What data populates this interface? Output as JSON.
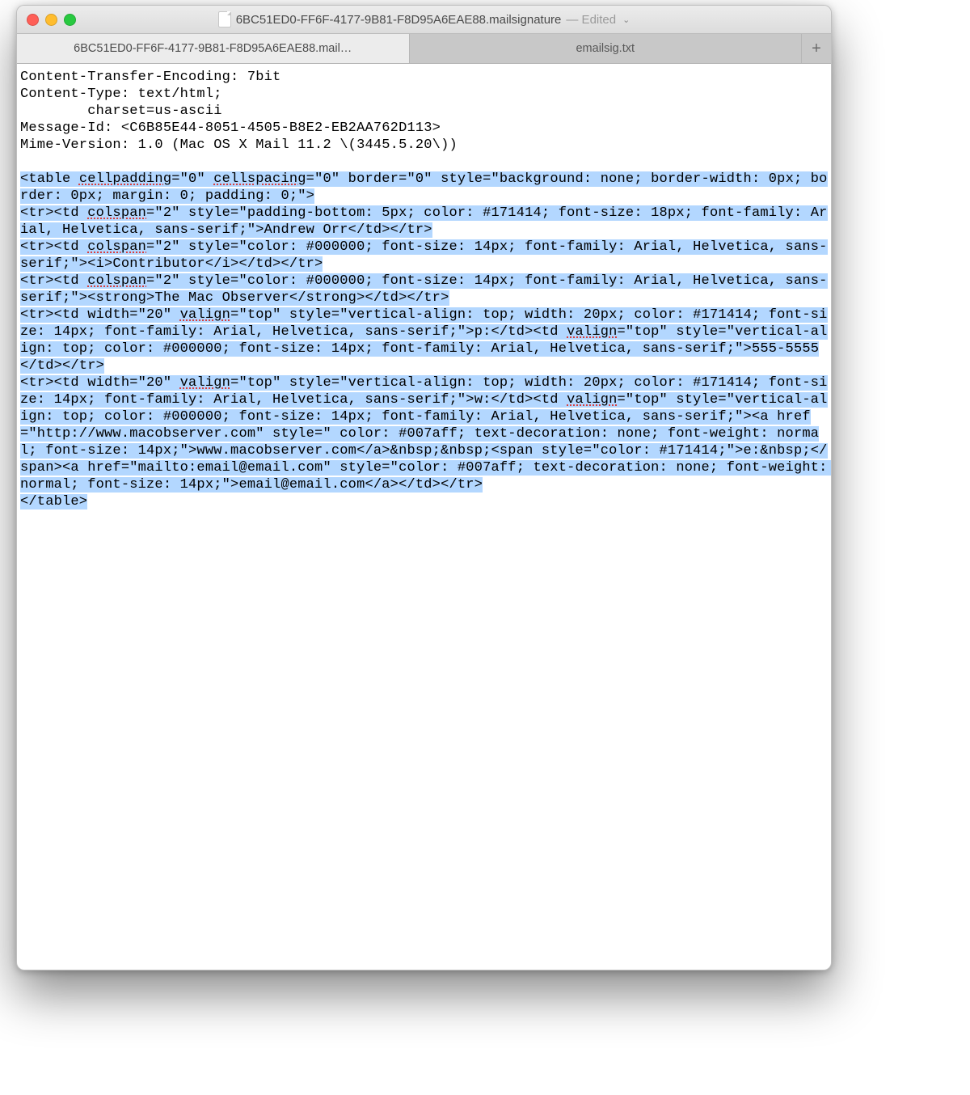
{
  "window": {
    "filename": "6BC51ED0-FF6F-4177-9B81-F8D95A6EAE88.mailsignature",
    "status": "— Edited"
  },
  "tabs": {
    "active": "6BC51ED0-FF6F-4177-9B81-F8D95A6EAE88.mail…",
    "inactive": "emailsig.txt",
    "newtab": "+"
  },
  "headers": {
    "l1": "Content-Transfer-Encoding: 7bit",
    "l2": "Content-Type: text/html;",
    "l3": "        charset=us-ascii",
    "l4": "Message-Id: <C6B85E44-8051-4505-B8E2-EB2AA762D113>",
    "l5": "Mime-Version: 1.0 (Mac OS X Mail 11.2 \\(3445.5.20\\))"
  },
  "body": {
    "s01a": "<table ",
    "s01b": "cellpadding",
    "s01c": "=\"0\" ",
    "s01d": "cellspacing",
    "s01e": "=\"0\" border=\"0\" style=\"background: none; border-width: 0px; border: 0px; margin: 0; padding: 0;\">",
    "s02a": "<tr><td ",
    "s02b": "colspan",
    "s02c": "=\"2\" style=\"padding-bottom: 5px; color: #171414; font-size: 18px; font-family: Arial, Helvetica, sans-serif;\">Andrew Orr</td></tr>",
    "s03a": "<tr><td ",
    "s03b": "colspan",
    "s03c": "=\"2\" style=\"color: #000000; font-size: 14px; font-family: Arial, Helvetica, sans-serif;\"><i>Contributor</i></td></tr>",
    "s04a": "<tr><td ",
    "s04b": "colspan",
    "s04c": "=\"2\" style=\"color: #000000; font-size: 14px; font-family: Arial, Helvetica, sans-serif;\"><strong>The Mac Observer</strong></td></tr>",
    "s05a": "<tr><td width=\"20\" ",
    "s05b": "valign",
    "s05c": "=\"top\" style=\"vertical-align: top; width: 20px; color: #171414; font-size: 14px; font-family: Arial, Helvetica, sans-serif;\">p:</td><td ",
    "s05d": "valign",
    "s05e": "=\"top\" style=\"vertical-align: top; color: #000000; font-size: 14px; font-family: Arial, Helvetica, sans-serif;\">555-5555</td></tr>",
    "s06a": "<tr><td width=\"20\" ",
    "s06b": "valign",
    "s06c": "=\"top\" style=\"vertical-align: top; width: 20px; color: #171414; font-size: 14px; font-family: Arial, Helvetica, sans-serif;\">w:</td><td ",
    "s06d": "valign",
    "s06e": "=\"top\" style=\"vertical-align: top; color: #000000; font-size: 14px; font-family: Arial, Helvetica, sans-serif;\"><a href=\"http://www.macobserver.com\" style=\" color: #007aff; text-decoration: none; font-weight: normal; font-size: 14px;\">www.macobserver.com</a>&nbsp;&nbsp;<span style=\"color: #171414;\">e:&nbsp;</span><a href=\"mailto:email@email.com\" style=\"color: #007aff; text-decoration: none; font-weight: normal; font-size: 14px;\">email@email.com</a></td></tr>",
    "s07": "</table>"
  }
}
